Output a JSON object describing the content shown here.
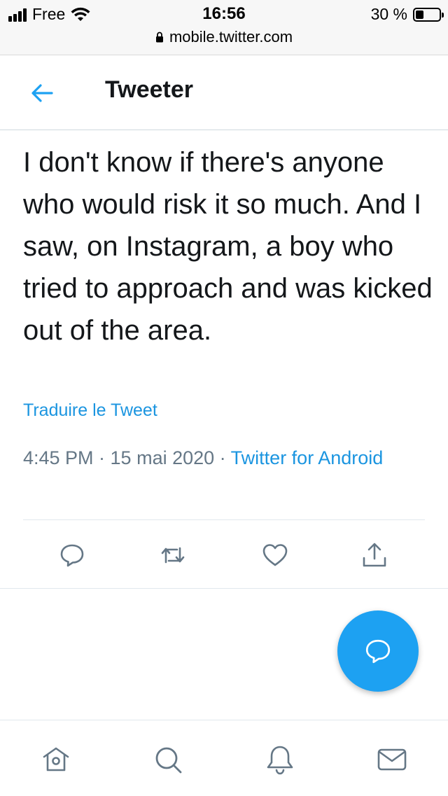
{
  "status_bar": {
    "carrier": "Free",
    "time": "16:56",
    "battery": "30 %",
    "battery_level": 0.3,
    "url": "mobile.twitter.com"
  },
  "header": {
    "title": "Tweeter",
    "back_icon": "arrow-left-icon"
  },
  "tweet": {
    "text": "I don't know if there's anyone who would risk it so much. And I saw, on Instagram, a boy who tried to approach and was kicked out of the area.",
    "translate_label": "Traduire le Tweet",
    "timestamp": "4:45 PM · 15 mai 2020 · ",
    "source": "Twitter for Android"
  },
  "actions": [
    {
      "name": "reply-icon"
    },
    {
      "name": "retweet-icon"
    },
    {
      "name": "like-icon"
    },
    {
      "name": "share-icon"
    }
  ],
  "fab": {
    "icon": "compose-reply-icon"
  },
  "bottom_nav": [
    {
      "name": "home-icon"
    },
    {
      "name": "search-icon"
    },
    {
      "name": "notifications-icon"
    },
    {
      "name": "messages-icon"
    }
  ],
  "colors": {
    "accent": "#1da1f2",
    "link": "#1b95e0",
    "icon": "#657786",
    "text": "#14171a"
  }
}
